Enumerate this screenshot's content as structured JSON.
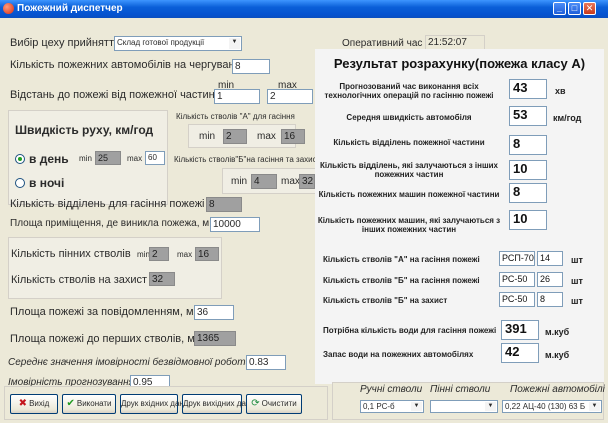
{
  "window": {
    "title": "Пожежний диспетчер"
  },
  "left": {
    "shop_label": "Вибір цеху прийняття",
    "shop_value": "Склад готової продукції",
    "trucks_on_duty_label": "Кількість пожежних автомобілів на чергуванні",
    "trucks_on_duty_value": "8",
    "distance_label": "Відстань до пожежі від пожежної частини, км",
    "distance_min_label": "min",
    "distance_max_label": "max",
    "distance_min_value": "1",
    "distance_max_value": "2",
    "speed_title": "Швидкість руху, км/год",
    "day_label": "в день",
    "night_label": "в ночі",
    "speed_min_label": "min",
    "speed_max_label": "max",
    "speed_min_value": "25",
    "speed_max_value": "60",
    "stvol_a_title": "Кількість стволів \"А\" для гасіння",
    "stvol_a_min_label": "min",
    "stvol_a_max_label": "max",
    "stvol_a_min_value": "2",
    "stvol_a_max_value": "16",
    "stvol_b_title": "Кількість стволів\"Б\"на гасіння та захист",
    "stvol_b_min_label": "min",
    "stvol_b_max_label": "max",
    "stvol_b_min_value": "4",
    "stvol_b_max_value": "32",
    "divisions_label": "Кількість відділень для гасіння пожежі",
    "divisions_value": "8",
    "area_label": "Площа приміщення, де виникла пожежа, м.кв.",
    "area_value": "10000",
    "foam_label": "Кількість пінних стволів",
    "foam_min_label": "min",
    "foam_max_label": "max",
    "foam_min_value": "2",
    "foam_max_value": "16",
    "protect_label": "Кількість стволів на захист",
    "protect_value": "32",
    "area_report_label": "Площа пожежі за повідомленням, м.кв.",
    "area_report_value": "36",
    "area_first_label": "Площа пожежі до перших стволів, м.кв.",
    "area_first_value": "1365",
    "prob_mean_label": "Середнє значення імовірності безвідмовної роботи",
    "prob_mean_value": "0.83",
    "prob_forecast_label": "Імовірність прогнозування",
    "prob_forecast_value": "0.95"
  },
  "top": {
    "op_time_label": "Оперативний час",
    "op_time_value": "21:52:07"
  },
  "result": {
    "title": "Результат розрахунку(пожежа класу А)",
    "forecast_label": "Прогнозований час виконання всіх технологічних операцій по гасінню пожежі",
    "forecast_value": "43",
    "forecast_unit": "хв",
    "avg_speed_label": "Середня швидкість автомобіля",
    "avg_speed_value": "53",
    "avg_speed_unit": "км/год",
    "divisions_label": "Кількість відділень пожежної частини",
    "divisions_value": "8",
    "other_div_label": "Кількість відділень, які залучаються з інших пожежних частин",
    "other_div_value": "10",
    "trucks_label": "Кількість пожежних машин пожежної частини",
    "trucks_value": "8",
    "other_trucks_label": "Кількість пожежних машин, які залучаються з інших пожежних частин",
    "other_trucks_value": "10",
    "stvol_a_label": "Кількість стволів \"А\" на гасіння пожежі",
    "stvol_a_type": "РСП-70",
    "stvol_a_count": "14",
    "stvol_b_label": "Кількість стволів \"Б\" на гасіння пожежі",
    "stvol_b_type": "РС-50",
    "stvol_b_count": "26",
    "stvol_prot_label": "Кількість стволів \"Б\" на захист",
    "stvol_prot_type": "РС-50",
    "stvol_prot_count": "8",
    "unit_sht": "шт",
    "water_need_label": "Потрібна кількість води для гасіння пожежі",
    "water_need_value": "391",
    "water_need_unit": "м.куб",
    "water_stock_label": "Запас води на пожежних автомобілях",
    "water_stock_value": "42",
    "water_stock_unit": "м.куб"
  },
  "buttons": {
    "exit": "Вихід",
    "run": "Виконати",
    "print_in": "Друк вхідних даних",
    "print_out": "Друк вихідних даних",
    "clear": "Очистити"
  },
  "bottom": {
    "manual_label": "Ручні стволи",
    "foam_label": "Пінні стволи",
    "trucks_label": "Пожежні автомобілі",
    "manual_value": "0,1   РС-б",
    "foam_value": "",
    "trucks_value": "0,22   АЦ-40 (130) 63 Б"
  },
  "colors": {
    "titlebar": "#0a5fd8",
    "readonly_box": "#a0a0a0",
    "window_bg": "#ece9d8"
  }
}
